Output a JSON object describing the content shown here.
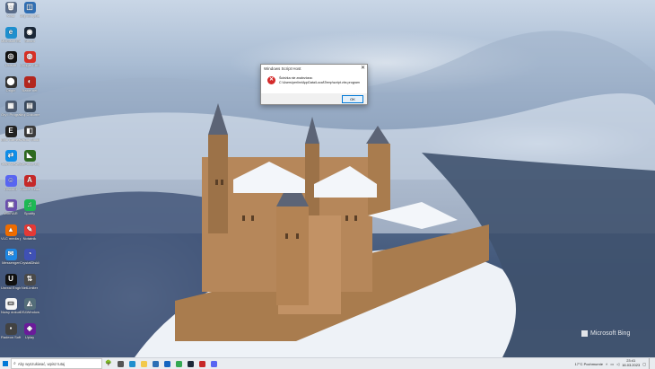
{
  "desktop": {
    "icons": [
      {
        "label": "Kosz",
        "color": "#5a6d8a",
        "glyph": "🗑"
      },
      {
        "label": "Mój komputer",
        "color": "#2f6fb5",
        "glyph": "◫"
      },
      {
        "label": "Microsoft Edge",
        "color": "#1e8fce",
        "glyph": "e"
      },
      {
        "label": "Steam",
        "color": "#1b2838",
        "glyph": "◉"
      },
      {
        "label": "Ubisoft",
        "color": "#111111",
        "glyph": "◎"
      },
      {
        "label": "Google Chrome",
        "color": "#d93025",
        "glyph": "◍"
      },
      {
        "label": "Origin",
        "color": "#333333",
        "glyph": "⬤"
      },
      {
        "label": "Battle.net",
        "color": "#b3261e",
        "glyph": "◐"
      },
      {
        "label": "Gry i Programy",
        "color": "#4c5a70",
        "glyph": "▦"
      },
      {
        "label": "Mój Dokument",
        "color": "#3a4a5e",
        "glyph": "▤"
      },
      {
        "label": "Epic Games Launcher",
        "color": "#222222",
        "glyph": "E"
      },
      {
        "label": "Visual Studio Code",
        "color": "#3b3b3b",
        "glyph": "◧"
      },
      {
        "label": "TeamViewer",
        "color": "#0e8ee9",
        "glyph": "⇄"
      },
      {
        "label": "GeForce Experience",
        "color": "#2d6a1f",
        "glyph": "◣"
      },
      {
        "label": "Discord",
        "color": "#5865f2",
        "glyph": "☺"
      },
      {
        "label": "Adobe Reader",
        "color": "#c62828",
        "glyph": "A"
      },
      {
        "label": "WinRAR",
        "color": "#6b4fb0",
        "glyph": "▣"
      },
      {
        "label": "Spotify",
        "color": "#1db954",
        "glyph": "♫"
      },
      {
        "label": "VLC media player",
        "color": "#ef6c00",
        "glyph": "▲"
      },
      {
        "label": "Notatnik",
        "color": "#e53935",
        "glyph": "✎"
      },
      {
        "label": "Messenger",
        "color": "#1e88e5",
        "glyph": "✉"
      },
      {
        "label": "CrystalDiskMark",
        "color": "#3f51b5",
        "glyph": "◔"
      },
      {
        "label": "Unreal Engine",
        "color": "#111111",
        "glyph": "U"
      },
      {
        "label": "NetLimiter",
        "color": "#4a4a4a",
        "glyph": "⇅"
      },
      {
        "label": "Nowy dokument",
        "color": "#f5f5f5",
        "glyph": "▭"
      },
      {
        "label": "DS4Windows",
        "color": "#546e7a",
        "glyph": "◭"
      },
      {
        "label": "Radeon Software",
        "color": "#424242",
        "glyph": "▪"
      },
      {
        "label": "Uplay",
        "color": "#6a1b9a",
        "glyph": "◈"
      }
    ]
  },
  "dialog": {
    "title": "Windows Script Host",
    "close": "✕",
    "message_line1": "Ścieżka nie znaleziona:",
    "message_line2": "C:\\Users\\perlinr\\AppData\\Local\\Temp\\script.vbs program",
    "ok_label": "OK"
  },
  "taskbar": {
    "search_placeholder": "Aby wyszukiwać, wpisz tutaj",
    "weather": "17°C Pochmurnie",
    "time": "23:41",
    "date": "16.03.2023",
    "apps": [
      {
        "name": "task-view-icon",
        "color": "#555555"
      },
      {
        "name": "edge-icon",
        "color": "#1e8fce"
      },
      {
        "name": "explorer-icon",
        "color": "#f2c94c"
      },
      {
        "name": "mail-icon",
        "color": "#2d6fb5"
      },
      {
        "name": "store-icon",
        "color": "#1565c0"
      },
      {
        "name": "chrome-icon",
        "color": "#34a853"
      },
      {
        "name": "steam-icon",
        "color": "#1b2838"
      },
      {
        "name": "red-app-icon",
        "color": "#c62828"
      },
      {
        "name": "discord-icon",
        "color": "#5865f2"
      }
    ]
  },
  "watermark": {
    "label": "Microsoft Bing"
  }
}
